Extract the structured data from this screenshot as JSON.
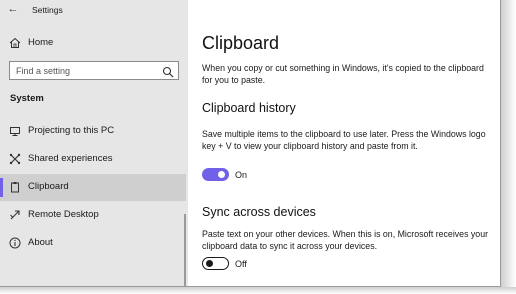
{
  "window": {
    "title": "Settings",
    "back_glyph": "←"
  },
  "sidebar": {
    "home_label": "Home",
    "search_placeholder": "Find a setting",
    "section_label": "System",
    "items": [
      {
        "label": "Projecting to this PC",
        "icon": "projector-icon"
      },
      {
        "label": "Shared experiences",
        "icon": "shared-experiences-icon"
      },
      {
        "label": "Clipboard",
        "icon": "clipboard-icon",
        "selected": true
      },
      {
        "label": "Remote Desktop",
        "icon": "remote-desktop-icon"
      },
      {
        "label": "About",
        "icon": "info-icon"
      }
    ],
    "accent_color": "#7160e8"
  },
  "main": {
    "title": "Clipboard",
    "intro": "When you copy or cut something in Windows, it's copied to the clipboard for you to paste.",
    "history": {
      "heading": "Clipboard history",
      "description": "Save multiple items to the clipboard to use later. Press the Windows logo key + V to view your clipboard history and paste from it.",
      "state_label": "On",
      "enabled": true
    },
    "sync": {
      "heading": "Sync across devices",
      "description": "Paste text on your other devices. When this is on, Microsoft receives your clipboard data to sync it across your devices.",
      "state_label": "Off",
      "enabled": false
    }
  }
}
